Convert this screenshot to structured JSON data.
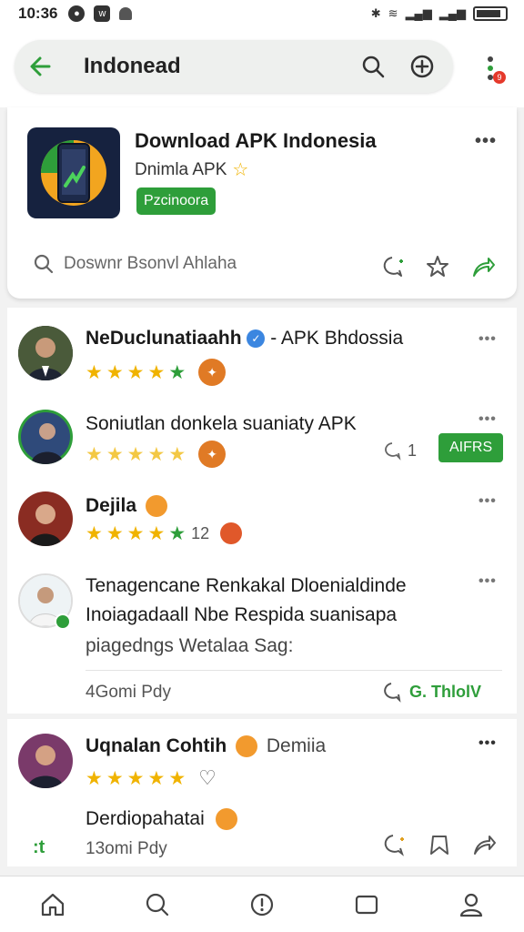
{
  "status_bar": {
    "time": "10:36"
  },
  "app_bar": {
    "search_text": "Indonead",
    "notification_count": "9"
  },
  "app_card": {
    "title": "Download APK Indonesia",
    "subtitle": "Dnimla APK",
    "tag": "Pzcinoora",
    "search_text": "Doswnr Bsonvl Ahlaha"
  },
  "posts": [
    {
      "author": "NeDuclunatiaahh",
      "suffix": "- APK Bhdossia",
      "rating_stars": 5
    },
    {
      "author": "Soniutlan donkela suaniaty APK",
      "count": "1",
      "follow_label": "AIFRS",
      "rating_stars": 5
    },
    {
      "author": "Dejila",
      "count": "12",
      "rating_stars": 5
    },
    {
      "line1": "Tenagencane Renkakal Dloenialdinde",
      "line2": "Inoiagadaall Nbe Respida suanisapa",
      "line3": "piagedngs Wetalaa Sag:",
      "meta": "4Gomi Pdy",
      "action_label": "G. ThlolV"
    }
  ],
  "post5": {
    "author": "Uqnalan Cohtih",
    "suffix": "Demiia",
    "body": "Derdiopahatai",
    "meta": "13omi Pdy",
    "side_label": ":t"
  },
  "colors": {
    "accent": "#2e9e3a",
    "star": "#f0b300",
    "badge": "#e07a25",
    "notification": "#e5392b"
  }
}
